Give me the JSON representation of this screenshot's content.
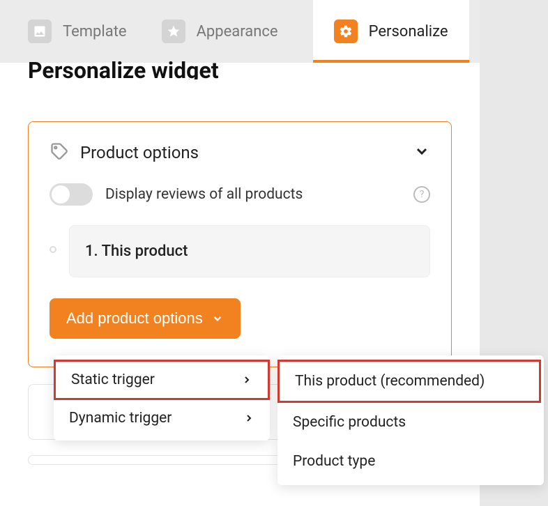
{
  "tabs": {
    "template": "Template",
    "appearance": "Appearance",
    "personalize": "Personalize"
  },
  "page_title": "Personalize widget",
  "card": {
    "title": "Product options",
    "toggle_label": "Display reviews of all products",
    "product_entry": "1. This product",
    "add_button": "Add product options"
  },
  "menu1": {
    "static": "Static trigger",
    "dynamic": "Dynamic trigger"
  },
  "menu2": {
    "this_product": "This product (recommended)",
    "specific": "Specific products",
    "type": "Product type"
  }
}
